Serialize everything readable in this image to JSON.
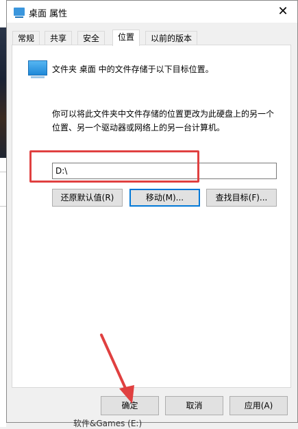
{
  "window": {
    "title": "桌面 属性"
  },
  "tabs": [
    {
      "label": "常规"
    },
    {
      "label": "共享"
    },
    {
      "label": "安全"
    },
    {
      "label": "位置"
    },
    {
      "label": "以前的版本"
    }
  ],
  "location": {
    "info": "文件夹 桌面 中的文件存储于以下目标位置。",
    "description": "你可以将此文件夹中文件存储的位置更改为此硬盘上的另一个位置、另一个驱动器或网络上的另一台计算机。",
    "path_value": "D:\\",
    "restore_label": "还原默认值(R)",
    "move_label": "移动(M)...",
    "find_label": "查找目标(F)..."
  },
  "footer": {
    "ok_label": "确定",
    "cancel_label": "取消",
    "apply_label": "应用(A)"
  },
  "background": {
    "bottom_text": "软件&Games (E:)"
  },
  "colors": {
    "accent": "#0078d7",
    "annotation": "#e04040"
  }
}
